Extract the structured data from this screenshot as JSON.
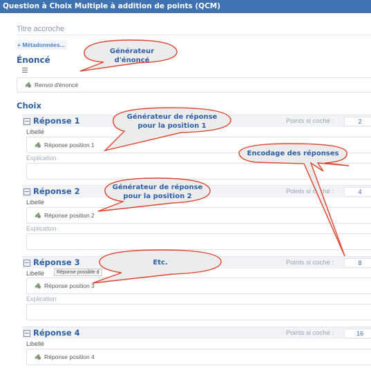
{
  "window": {
    "title": "Question à Choix Multiple à addition de points (QCM)"
  },
  "fields": {
    "titre_placeholder": "Titre accroche",
    "metadonnees_link": "+ Métadonnées..."
  },
  "enonce": {
    "section_title": "Énoncé",
    "renvoi": "Renvoi d'énoncé"
  },
  "choix": {
    "section_title": "Choix",
    "libelle_label": "Libellé",
    "explication_label": "Explication",
    "points_label": "Points si coché :",
    "reponses": [
      {
        "title": "Réponse 1",
        "points": "2",
        "libelle_ref": "Réponse position 1"
      },
      {
        "title": "Réponse 2",
        "points": "4",
        "libelle_ref": "Réponse position 2"
      },
      {
        "title": "Réponse 3",
        "points": "8",
        "libelle_ref": "Réponse position 3"
      },
      {
        "title": "Réponse 4",
        "points": "16",
        "libelle_ref": "Réponse position 4"
      }
    ],
    "tooltip": "Réponse possible d"
  },
  "callouts": {
    "enonce": "Générateur d'énoncé",
    "reponse1_line1": "Générateur de réponse",
    "reponse1_line2": "pour la position 1",
    "encodage": "Encodage des réponses",
    "reponse2_line1": "Générateur de réponse",
    "reponse2_line2": "pour la position 2",
    "etc": "Etc."
  },
  "colors": {
    "titlebar": "#3f72b1",
    "accent": "#2f5f9e",
    "callout_fill": "#ececec",
    "callout_stroke": "#e0432b"
  }
}
